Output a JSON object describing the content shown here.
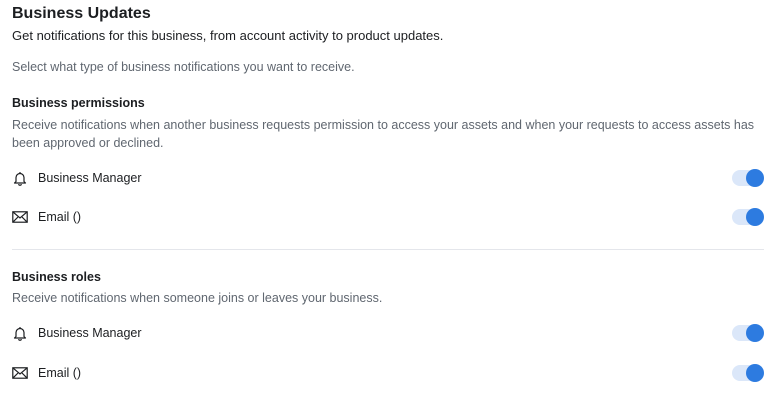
{
  "header": {
    "title": "Business Updates",
    "subtitle": "Get notifications for this business, from account activity to product updates.",
    "intro": "Select what type of business notifications you want to receive."
  },
  "sections": [
    {
      "title": "Business permissions",
      "description": "Receive notifications when another business requests permission to access your assets and when your requests to access assets has been approved or declined.",
      "items": [
        {
          "icon": "bell-icon",
          "label": "Business Manager",
          "enabled": true
        },
        {
          "icon": "envelope-icon",
          "label": "Email ()",
          "enabled": true
        }
      ]
    },
    {
      "title": "Business roles",
      "description": "Receive notifications when someone joins or leaves your business.",
      "items": [
        {
          "icon": "bell-icon",
          "label": "Business Manager",
          "enabled": true
        },
        {
          "icon": "envelope-icon",
          "label": "Email ()",
          "enabled": true
        }
      ]
    }
  ],
  "colors": {
    "toggle_on": "#2d7be0",
    "toggle_track": "#dbe7f9",
    "muted_text": "#606770"
  }
}
